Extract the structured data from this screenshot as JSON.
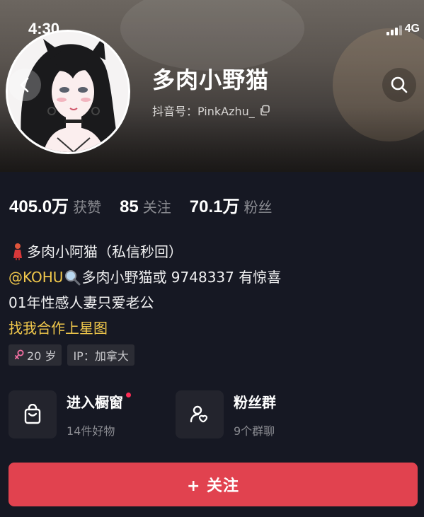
{
  "status_bar": {
    "time": "4:30",
    "network": "4G"
  },
  "profile": {
    "nickname": "多肉小野猫",
    "douyin_id": "抖音号：PinkAzhu_"
  },
  "stats": [
    {
      "value": "405.0万",
      "label": "获赞"
    },
    {
      "value": "85",
      "label": "关注"
    },
    {
      "value": "70.1万",
      "label": "粉丝"
    }
  ],
  "bio": {
    "line1": "多肉小阿猫（私信秒回）",
    "line2_mention": "@KOHU",
    "line2_text": "多肉小野猫或 9748337 有惊喜",
    "line3": "01年性感人妻只爱老公",
    "line4": "找我合作上星图"
  },
  "tags": {
    "age": "20 岁",
    "ip": "IP：加拿大"
  },
  "cards": {
    "shop": {
      "title": "进入橱窗",
      "subtitle": "14件好物"
    },
    "fans_group": {
      "title": "粉丝群",
      "subtitle": "9个群聊"
    }
  },
  "follow_button": {
    "label": "+ 关注"
  },
  "colors": {
    "accent": "#e1424f",
    "background": "#161823",
    "highlight": "#f2c94c"
  },
  "icons": [
    "back-icon",
    "search-icon",
    "copy-icon",
    "shopping-bag-icon",
    "fans-group-icon",
    "female-icon",
    "magnifier-emoji-icon",
    "figure-emoji-icon"
  ]
}
